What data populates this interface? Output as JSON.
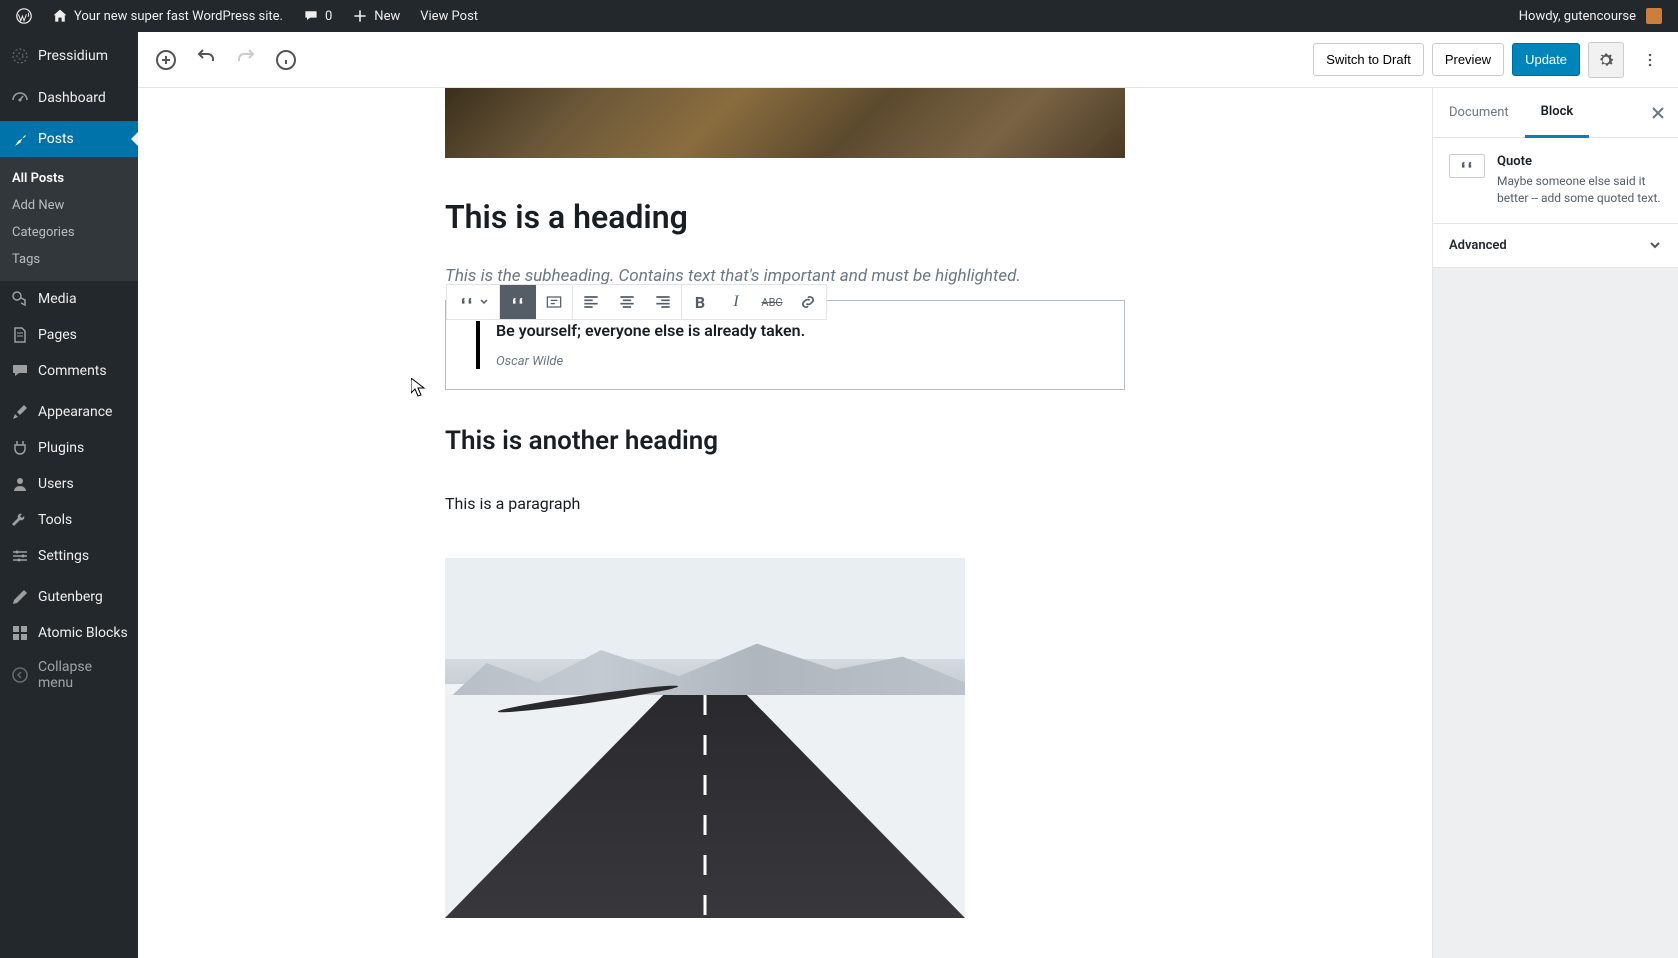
{
  "adminbar": {
    "site_name": "Your new super fast WordPress site.",
    "comments_count": "0",
    "new_label": "New",
    "view_post": "View Post",
    "howdy": "Howdy, gutencourse"
  },
  "sidebar": {
    "brand": "Pressidium",
    "items": [
      {
        "label": "Dashboard",
        "icon": "dashboard"
      },
      {
        "label": "Posts",
        "icon": "posts",
        "current": true
      },
      {
        "label": "Media",
        "icon": "media"
      },
      {
        "label": "Pages",
        "icon": "pages"
      },
      {
        "label": "Comments",
        "icon": "comments"
      },
      {
        "label": "Appearance",
        "icon": "appearance"
      },
      {
        "label": "Plugins",
        "icon": "plugins"
      },
      {
        "label": "Users",
        "icon": "users"
      },
      {
        "label": "Tools",
        "icon": "tools"
      },
      {
        "label": "Settings",
        "icon": "settings"
      },
      {
        "label": "Gutenberg",
        "icon": "gutenberg"
      },
      {
        "label": "Atomic Blocks",
        "icon": "atomic"
      },
      {
        "label": "Collapse menu",
        "icon": "collapse"
      }
    ],
    "sub_posts": [
      {
        "label": "All Posts",
        "current": true
      },
      {
        "label": "Add New"
      },
      {
        "label": "Categories"
      },
      {
        "label": "Tags"
      }
    ]
  },
  "editor_header": {
    "switch_draft": "Switch to Draft",
    "preview": "Preview",
    "update": "Update"
  },
  "content": {
    "heading1": "This is a heading",
    "subheading": "This is the subheading. Contains text that's important and must be highlighted.",
    "quote_text": "Be yourself; everyone else is already taken.",
    "quote_cite": "Oscar Wilde",
    "heading2": "This is another heading",
    "paragraph": "This is a paragraph"
  },
  "inspector": {
    "tab_document": "Document",
    "tab_block": "Block",
    "block_title": "Quote",
    "block_desc": "Maybe someone else said it better -- add some quoted text.",
    "advanced": "Advanced"
  }
}
